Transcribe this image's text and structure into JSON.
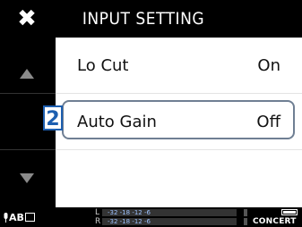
{
  "header": {
    "title": "INPUT SETTING",
    "close_glyph": "✖"
  },
  "menu": {
    "items": [
      {
        "label": "Lo Cut",
        "value": "On"
      },
      {
        "label": "Auto Gain",
        "value": "Off"
      },
      {
        "label": "",
        "value": ""
      }
    ],
    "selected_index": 1
  },
  "callout": {
    "number": "2"
  },
  "status": {
    "input_label": "AB",
    "channel_l": "L",
    "channel_r": "R",
    "meter_scale": "-32 -18  -12   -6",
    "scene": "CONCERT"
  },
  "colors": {
    "callout": "#1d5fb0",
    "highlight_border": "#6f7f93"
  }
}
